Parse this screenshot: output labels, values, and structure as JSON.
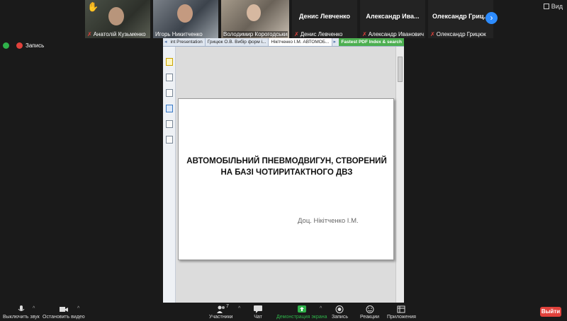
{
  "participants": [
    {
      "name": "Анатолій Кузьменко",
      "has_video": true,
      "raised_hand": true
    },
    {
      "name": "Игорь Никитченко",
      "has_video": true,
      "raised_hand": false
    },
    {
      "name": "Володимир Корогодський",
      "has_video": true,
      "raised_hand": false
    },
    {
      "name": "Денис Левченко",
      "tile_title": "Денис Левченко",
      "has_video": false
    },
    {
      "name": "Александр Иванович",
      "tile_title": "Александр Ива...",
      "has_video": false
    },
    {
      "name": "Олександр Грицюк",
      "tile_title": "Олександр Гриц...",
      "has_video": false
    }
  ],
  "top_bar": {
    "view_label": "Вид"
  },
  "recording": {
    "label": "Запись"
  },
  "viewer": {
    "tabs": [
      "int Presentation",
      "Грицюк О.В. Вибір форм і...",
      "Нікітченко І.М. АВТОМОБ..."
    ],
    "green_tab": "Fastest PDF Index & search",
    "slide": {
      "title_line1": "АВТОМОБІЛЬНИЙ ПНЕВМОДВИГУН, СТВОРЕНИЙ",
      "title_line2": "НА БАЗІ ЧОТИРИТАКТНОГО ДВЗ",
      "author": "Доц. Нікітченко І.М."
    }
  },
  "toolbar": {
    "mute": "Выключить звук",
    "video": "Остановить видео",
    "participants": "Участники",
    "participants_count": "7",
    "chat": "Чат",
    "share": "Демонстрация экрана",
    "record": "Запись",
    "reactions": "Реакции",
    "apps": "Приложения",
    "exit": "Выйти"
  },
  "colors": {
    "accent": "#2d8cff",
    "exit": "#e0413b",
    "share_green": "#2fb14a"
  }
}
